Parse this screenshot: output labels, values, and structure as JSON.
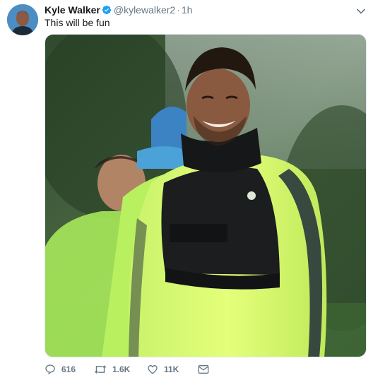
{
  "tweet": {
    "author_name": "Kyle Walker",
    "handle": "@kylewalker2",
    "separator": "·",
    "time": "1h",
    "text": "This will be fun",
    "verified": true
  },
  "actions": {
    "reply_count": "616",
    "retweet_count": "1.6K",
    "like_count": "11K"
  },
  "icons": {
    "verified": "verified-badge-icon",
    "caret": "chevron-down-icon",
    "reply": "reply-icon",
    "retweet": "retweet-icon",
    "like": "heart-icon",
    "dm": "envelope-icon"
  },
  "colors": {
    "verified": "#1da1f2",
    "muted": "#657786",
    "text": "#14171a"
  }
}
